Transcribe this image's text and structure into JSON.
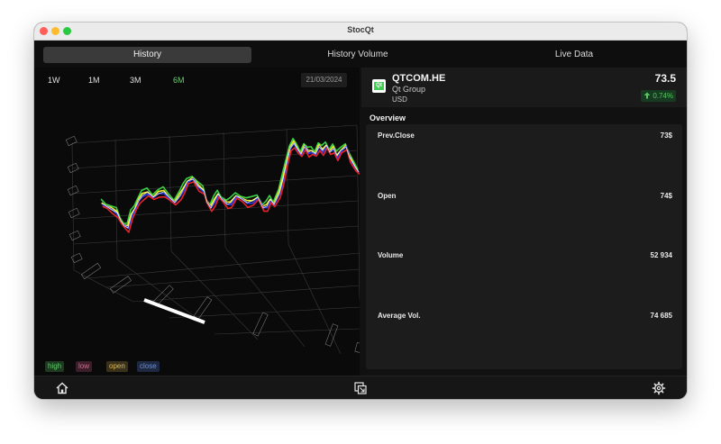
{
  "window": {
    "title": "StocQt"
  },
  "tabs": [
    {
      "label": "History",
      "active": true
    },
    {
      "label": "History Volume",
      "active": false
    },
    {
      "label": "Live Data",
      "active": false
    }
  ],
  "history": {
    "periods": [
      {
        "label": "1W",
        "active": false
      },
      {
        "label": "1M",
        "active": false
      },
      {
        "label": "3M",
        "active": false
      },
      {
        "label": "6M",
        "active": true
      }
    ],
    "date": "21/03/2024",
    "legend": [
      {
        "label": "high",
        "color": "#5fc86a"
      },
      {
        "label": "low",
        "color": "#d06d8c"
      },
      {
        "label": "open",
        "color": "#d8b75c"
      },
      {
        "label": "close",
        "color": "#6d8fd0"
      }
    ],
    "series_colors": {
      "high": "#3ad142",
      "low": "#e8232b",
      "open": "#f2ea2e",
      "close": "#2a3ef2",
      "highlight": "#ffffff"
    }
  },
  "stock": {
    "symbol": "QTCOM.HE",
    "name": "Qt Group",
    "currency": "USD",
    "price": "73.5",
    "change": "0.74%",
    "change_icon": "arrow-up-icon",
    "logo_text": "Qt",
    "brand_color": "#41cd52"
  },
  "overview": {
    "title": "Overview",
    "rows": [
      {
        "label": "Prev.Close",
        "value": "73$"
      },
      {
        "label": "Open",
        "value": "74$"
      },
      {
        "label": "Volume",
        "value": "52 934"
      },
      {
        "label": "Average Vol.",
        "value": "74 685"
      }
    ]
  },
  "bottombar": {
    "icons": [
      "home-icon",
      "window-toggle-icon",
      "settings-gear-icon"
    ]
  }
}
